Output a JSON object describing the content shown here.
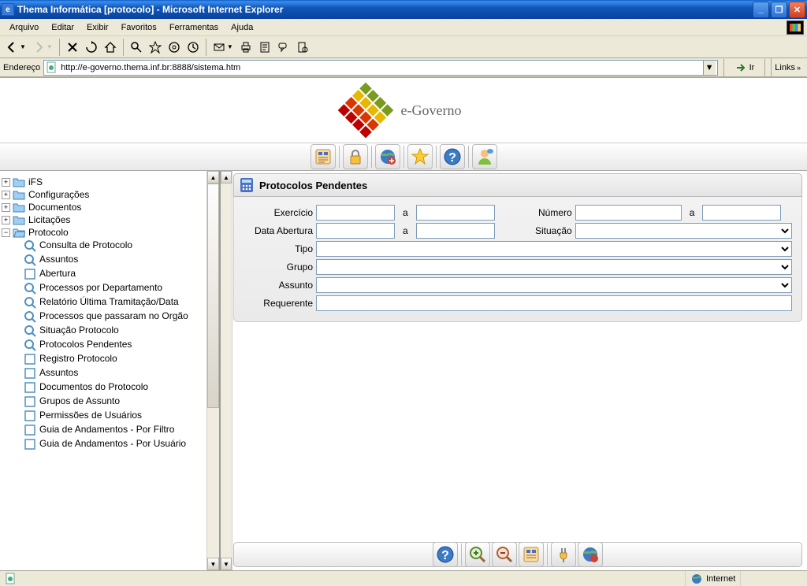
{
  "titlebar": {
    "text": "Thema Informática [protocolo] - Microsoft Internet Explorer"
  },
  "menu": {
    "items": [
      "Arquivo",
      "Editar",
      "Exibir",
      "Favoritos",
      "Ferramentas",
      "Ajuda"
    ]
  },
  "address": {
    "label": "Endereço",
    "url": "http://e-governo.thema.inf.br:8888/sistema.htm",
    "go": "Ir",
    "links": "Links"
  },
  "logo_text": "e-Governo",
  "tree": {
    "roots": [
      {
        "label": "iFS",
        "expander": "+"
      },
      {
        "label": "Configurações",
        "expander": "+"
      },
      {
        "label": "Documentos",
        "expander": "+"
      },
      {
        "label": "Licitações",
        "expander": "+"
      },
      {
        "label": "Protocolo",
        "expander": "−"
      }
    ],
    "children": [
      {
        "label": "Consulta de Protocolo",
        "type": "query"
      },
      {
        "label": "Assuntos",
        "type": "query"
      },
      {
        "label": "Abertura",
        "type": "doc"
      },
      {
        "label": "Processos por Departamento",
        "type": "query"
      },
      {
        "label": "Relatório Última Tramitação/Data",
        "type": "query"
      },
      {
        "label": "Processos que passaram no Orgão",
        "type": "query"
      },
      {
        "label": "Situação Protocolo",
        "type": "query"
      },
      {
        "label": "Protocolos Pendentes",
        "type": "query"
      },
      {
        "label": "Registro Protocolo",
        "type": "doc"
      },
      {
        "label": "Assuntos",
        "type": "doc"
      },
      {
        "label": "Documentos do Protocolo",
        "type": "doc"
      },
      {
        "label": "Grupos de Assunto",
        "type": "doc"
      },
      {
        "label": "Permissões de Usuários",
        "type": "doc"
      },
      {
        "label": "Guia de Andamentos - Por Filtro",
        "type": "doc"
      },
      {
        "label": "Guia de Andamentos - Por Usuário",
        "type": "doc"
      }
    ]
  },
  "form": {
    "title": "Protocolos Pendentes",
    "labels": {
      "exercicio": "Exercício",
      "a": "a",
      "numero": "Número",
      "data_abertura": "Data Abertura",
      "situacao": "Situação",
      "tipo": "Tipo",
      "grupo": "Grupo",
      "assunto": "Assunto",
      "requerente": "Requerente"
    }
  },
  "status": {
    "zone": "Internet"
  }
}
